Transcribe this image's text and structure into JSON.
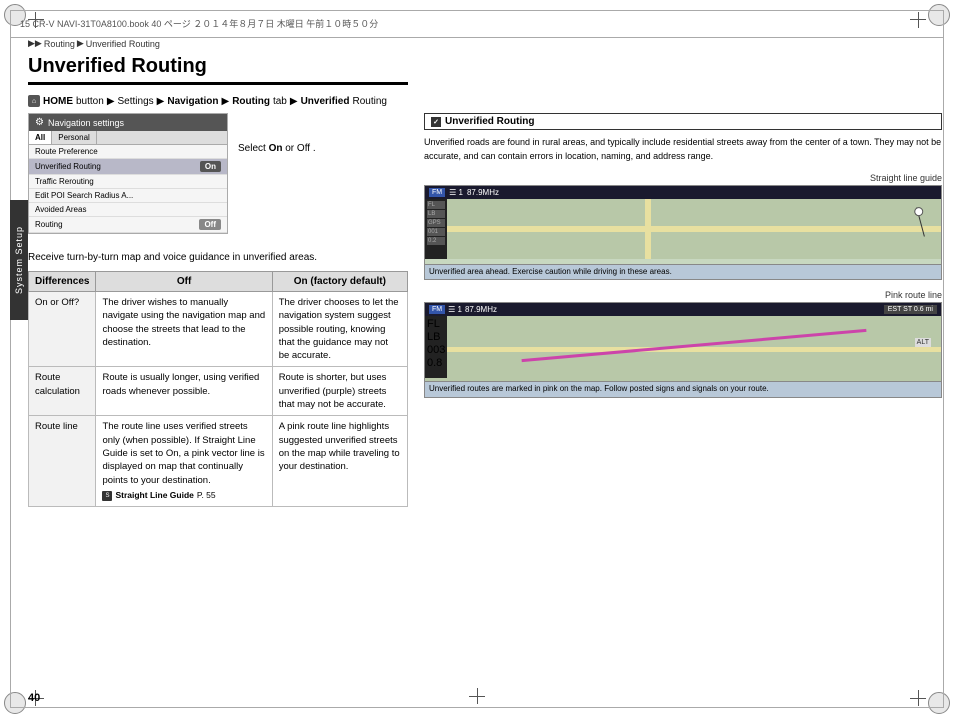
{
  "page": {
    "number": "40",
    "header_text": "15 CR-V NAVI-31T0A8100.book  40 ページ  ２０１４年８月７日  木曜日  午前１０時５０分"
  },
  "breadcrumb": {
    "arrow1": "▶▶",
    "item1": "Routing",
    "arrow2": "▶",
    "item2": "Unverified Routing"
  },
  "section": {
    "title": "Unverified Routing",
    "instruction_icon": "⌂",
    "instruction_parts": [
      "HOME button",
      "▶",
      "Settings",
      "▶",
      "Navigation",
      "▶",
      "Routing",
      "tab",
      "▶",
      "Unverified",
      "Routing"
    ],
    "body_text": "Receive turn-by-turn map and voice guidance in unverified areas.",
    "select_text": "Select",
    "on_text": "On",
    "or_text": "or",
    "off_text": "Off"
  },
  "nav_screenshot": {
    "header": "Navigation settings",
    "tabs": [
      "All",
      "Personal"
    ],
    "rows": [
      {
        "label": "Route Preference",
        "value": "",
        "active": false
      },
      {
        "label": "Unverified Routing",
        "value": "On",
        "active": true
      },
      {
        "label": "Traffic Rerouting",
        "value": "",
        "active": false
      },
      {
        "label": "Edit POI Search Radius A...",
        "value": "",
        "active": false
      },
      {
        "label": "Avoided Areas",
        "value": "",
        "active": false
      },
      {
        "label": "Routing",
        "value": "Off",
        "active": false
      }
    ]
  },
  "sidebar": {
    "label": "System Setup"
  },
  "table": {
    "headers": [
      "Differences",
      "Off",
      "On (factory default)"
    ],
    "rows": [
      {
        "label": "On or Off?",
        "off": "The driver wishes to manually navigate using the navigation map and choose the streets that lead to the destination.",
        "on": "The driver chooses to let the navigation system suggest possible routing, knowing that the guidance may not be accurate."
      },
      {
        "label": "Route\ncalculation",
        "off": "Route is usually longer, using verified roads whenever possible.",
        "on": "Route is shorter, but uses unverified (purple) streets that may not be accurate."
      },
      {
        "label": "Route line",
        "off": "The route line uses verified streets only (when possible). If Straight Line Guide is set to On, a pink vector line is displayed on map that continually points to your destination.",
        "on": "A pink route line highlights suggested unverified streets on the map while traveling to your destination.",
        "note": "Straight Line Guide P. 55"
      }
    ]
  },
  "right_panel": {
    "section_title": "Unverified Routing",
    "body_text": "Unverified roads are found in rural areas, and typically include residential streets away from the center of a town. They may not be accurate, and can contain errors in location, naming, and address range.",
    "map1": {
      "label": "Straight line guide",
      "fm_text": "FM",
      "freq": "87.9MHz",
      "caption": "Unverified area ahead. Exercise caution while driving in these areas."
    },
    "map2": {
      "label": "Pink route line",
      "fm_text": "FM",
      "freq": "87.9MHz",
      "est_text": "EST ST   0.6 mi",
      "caption": "Unverified routes are marked in pink on the map. Follow posted signs and signals on your route."
    }
  }
}
